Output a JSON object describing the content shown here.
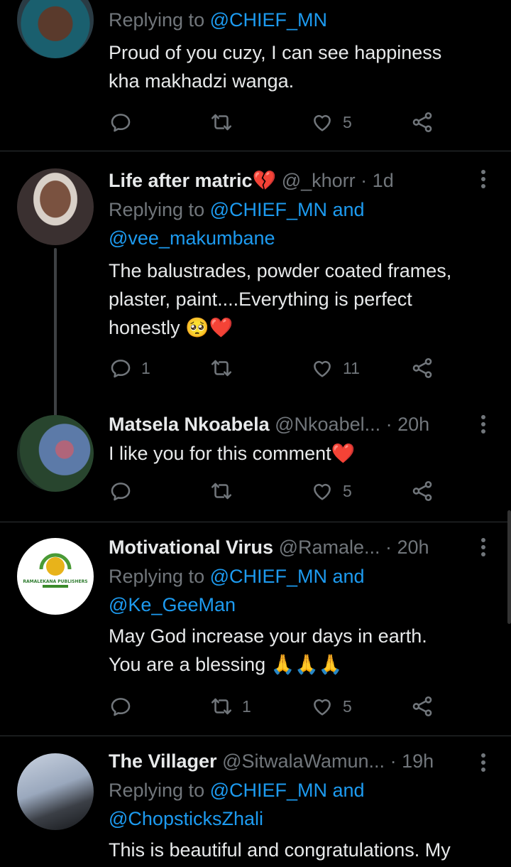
{
  "tweets": [
    {
      "replying_prefix": "Replying to ",
      "replying_mentions": "@CHIEF_MN",
      "text_lines": [
        "Proud of you cuzy, I can see happiness",
        "kha makhadzi wanga."
      ],
      "actions": {
        "replies": "",
        "retweets": "",
        "likes": "5"
      }
    },
    {
      "name": "Life after matric",
      "name_emoji": "💔",
      "handle": "@_khorr",
      "time": "1d",
      "replying_prefix": "Replying to ",
      "replying_mentions": "@CHIEF_MN and",
      "replying_line2": "@vee_makumbane",
      "text_lines": [
        "The balustrades, powder coated frames,",
        "plaster, paint....Everything is perfect",
        "honestly 🥺❤️"
      ],
      "actions": {
        "replies": "1",
        "retweets": "",
        "likes": "11"
      }
    },
    {
      "name": "Matsela Nkoabela",
      "handle": "@Nkoabel...",
      "time": "20h",
      "text_lines": [
        "I like you for this comment❤️"
      ],
      "actions": {
        "replies": "",
        "retweets": "",
        "likes": "5"
      }
    },
    {
      "name": "Motivational Virus",
      "handle": "@Ramale...",
      "time": "20h",
      "replying_prefix": "Replying to ",
      "replying_mentions": "@CHIEF_MN and",
      "replying_line2": "@Ke_GeeMan",
      "text_lines": [
        "May God increase your days in earth.",
        "You are a blessing 🙏🙏🙏"
      ],
      "avatar_logo_text": "RAMALEKANA PUBLISHERS",
      "actions": {
        "replies": "",
        "retweets": "1",
        "likes": "5"
      }
    },
    {
      "name": "The Villager",
      "handle": "@SitwalaWamun...",
      "time": "19h",
      "replying_prefix": "Replying to ",
      "replying_mentions": "@CHIEF_MN and",
      "replying_line2": "@ChopsticksZhali",
      "text_lines": [
        "This is beautiful and congratulations. My"
      ]
    }
  ],
  "separator": " · ",
  "icons": [
    "reply-icon",
    "retweet-icon",
    "like-icon",
    "share-icon",
    "more-options-icon"
  ],
  "colors": {
    "background": "#000000",
    "text": "#e7e9ea",
    "muted": "#71767b",
    "link": "#1d9bf0",
    "divider": "#2f3336"
  }
}
